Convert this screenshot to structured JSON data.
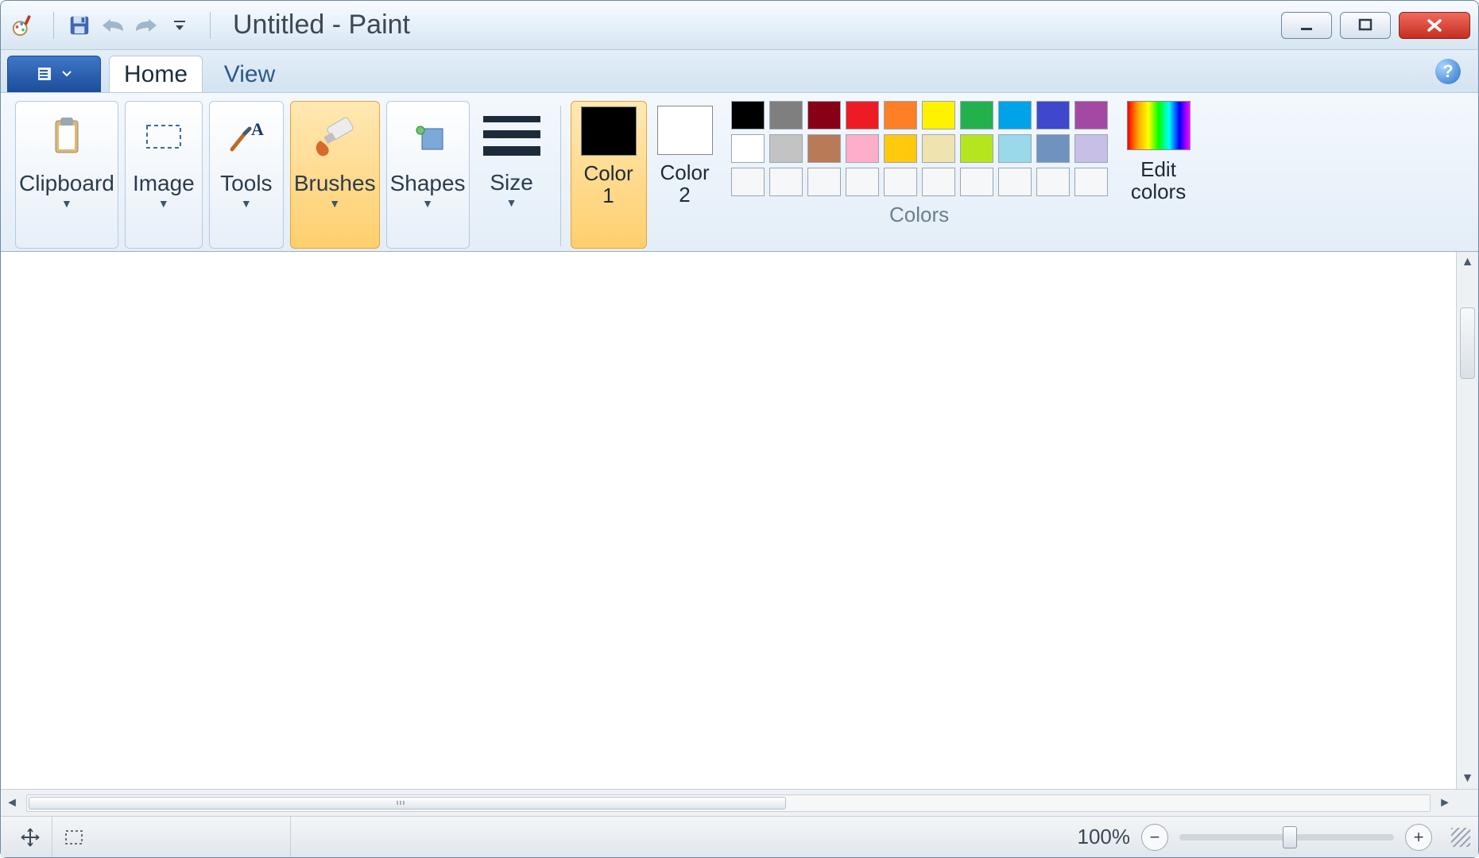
{
  "window": {
    "title": "Untitled - Paint"
  },
  "tabs": {
    "home": "Home",
    "view": "View"
  },
  "ribbon": {
    "clipboard": "Clipboard",
    "image": "Image",
    "tools": "Tools",
    "brushes": "Brushes",
    "shapes": "Shapes",
    "size": "Size",
    "color1": "Color\n1",
    "color2": "Color\n2",
    "edit_colors": "Edit\ncolors",
    "colors_group": "Colors",
    "color1_value": "#000000",
    "color2_value": "#FFFFFF"
  },
  "palette": {
    "row1": [
      "#000000",
      "#7F7F7F",
      "#880015",
      "#ED1C24",
      "#FF7F27",
      "#FFF200",
      "#22B14C",
      "#00A2E8",
      "#3F48CC",
      "#A349A4"
    ],
    "row2": [
      "#FFFFFF",
      "#C3C3C3",
      "#B97A57",
      "#FFAEC9",
      "#FFC90E",
      "#EFE4B0",
      "#B5E61D",
      "#99D9EA",
      "#7092BE",
      "#C8BFE7"
    ]
  },
  "status": {
    "zoom": "100%"
  }
}
